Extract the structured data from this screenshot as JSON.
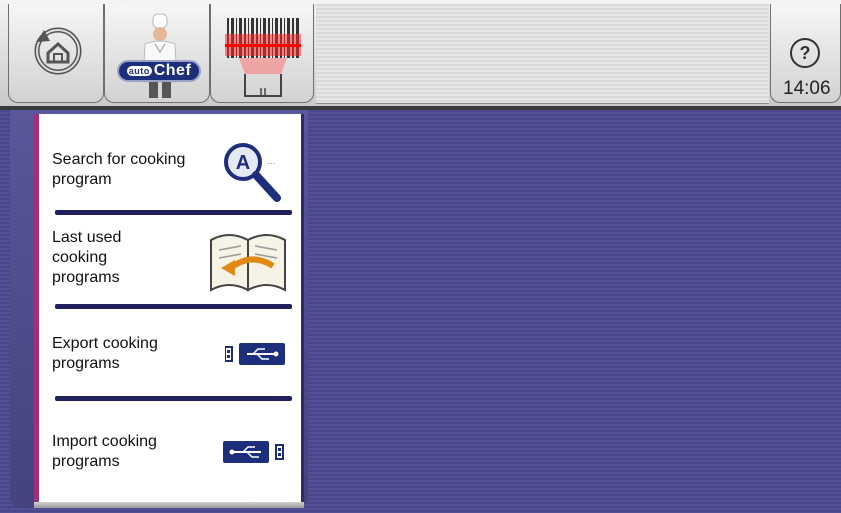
{
  "toolbar": {
    "back_icon": "back-home-icon",
    "chef_badge_auto": "auto",
    "chef_badge_chef": "Chef",
    "barcode_icon": "barcode-scanner-icon",
    "help_symbol": "?",
    "clock": "14:06"
  },
  "menu": {
    "items": [
      {
        "label": "Search for cooking program",
        "icon": "magnifier-a-icon"
      },
      {
        "label": "Last used cooking programs",
        "icon": "book-return-icon"
      },
      {
        "label": "Export cooking programs",
        "icon": "usb-export-icon"
      },
      {
        "label": "Import cooking programs",
        "icon": "usb-import-icon"
      }
    ]
  },
  "colors": {
    "background": "#4d498f",
    "accent_magenta": "#a0307a",
    "navy": "#1d2f7a",
    "separator": "#20205e"
  }
}
